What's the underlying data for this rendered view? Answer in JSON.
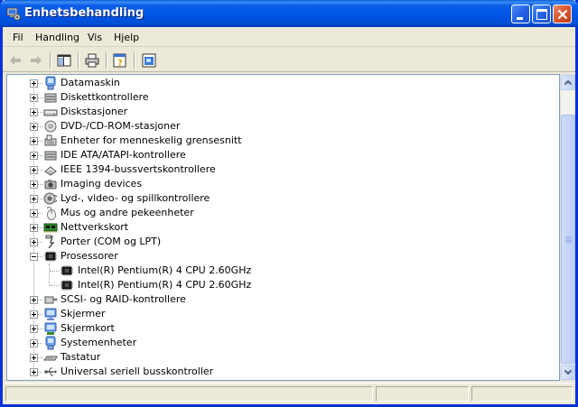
{
  "window": {
    "title": "Enhetsbehandling"
  },
  "menu": [
    {
      "label": "Fil"
    },
    {
      "label": "Handling"
    },
    {
      "label": "Vis"
    },
    {
      "label": "Hjelp"
    }
  ],
  "toolbar": {
    "buttons": [
      {
        "name": "back-icon",
        "enabled": false
      },
      {
        "name": "forward-icon",
        "enabled": false
      },
      {
        "name": "show-hide-console-tree-icon",
        "enabled": true
      },
      {
        "name": "print-icon",
        "enabled": true
      },
      {
        "name": "help-icon",
        "enabled": true
      },
      {
        "name": "properties-icon",
        "enabled": true
      }
    ]
  },
  "tree": {
    "items": [
      {
        "label": "Datamaskin",
        "icon": "computer-icon",
        "state": "collapsed"
      },
      {
        "label": "Diskettkontrollere",
        "icon": "floppy-controller-icon",
        "state": "collapsed"
      },
      {
        "label": "Diskstasjoner",
        "icon": "disk-drive-icon",
        "state": "collapsed"
      },
      {
        "label": "DVD-/CD-ROM-stasjoner",
        "icon": "cdrom-icon",
        "state": "collapsed"
      },
      {
        "label": "Enheter for menneskelig grensesnitt",
        "icon": "hid-icon",
        "state": "collapsed"
      },
      {
        "label": "IDE ATA/ATAPI-kontrollere",
        "icon": "ide-controller-icon",
        "state": "collapsed"
      },
      {
        "label": "IEEE 1394-bussvertskontrollere",
        "icon": "firewire-icon",
        "state": "collapsed"
      },
      {
        "label": "Imaging devices",
        "icon": "camera-icon",
        "state": "collapsed"
      },
      {
        "label": "Lyd-, video- og spillkontrollere",
        "icon": "sound-icon",
        "state": "collapsed"
      },
      {
        "label": "Mus og andre pekeenheter",
        "icon": "mouse-icon",
        "state": "collapsed"
      },
      {
        "label": "Nettverkskort",
        "icon": "network-card-icon",
        "state": "collapsed"
      },
      {
        "label": "Porter (COM og LPT)",
        "icon": "port-icon",
        "state": "collapsed"
      },
      {
        "label": "Prosessorer",
        "icon": "processor-icon",
        "state": "expanded",
        "children": [
          {
            "label": "Intel(R) Pentium(R) 4 CPU 2.60GHz",
            "icon": "processor-icon"
          },
          {
            "label": "Intel(R) Pentium(R) 4 CPU 2.60GHz",
            "icon": "processor-icon"
          }
        ]
      },
      {
        "label": "SCSI- og RAID-kontrollere",
        "icon": "scsi-icon",
        "state": "collapsed"
      },
      {
        "label": "Skjermer",
        "icon": "monitor-icon",
        "state": "collapsed"
      },
      {
        "label": "Skjermkort",
        "icon": "display-adapter-icon",
        "state": "collapsed"
      },
      {
        "label": "Systemenheter",
        "icon": "system-devices-icon",
        "state": "collapsed"
      },
      {
        "label": "Tastatur",
        "icon": "keyboard-icon",
        "state": "collapsed"
      },
      {
        "label": "Universal seriell busskontroller",
        "icon": "usb-icon",
        "state": "collapsed"
      }
    ]
  },
  "statusbar": {
    "text": ""
  }
}
